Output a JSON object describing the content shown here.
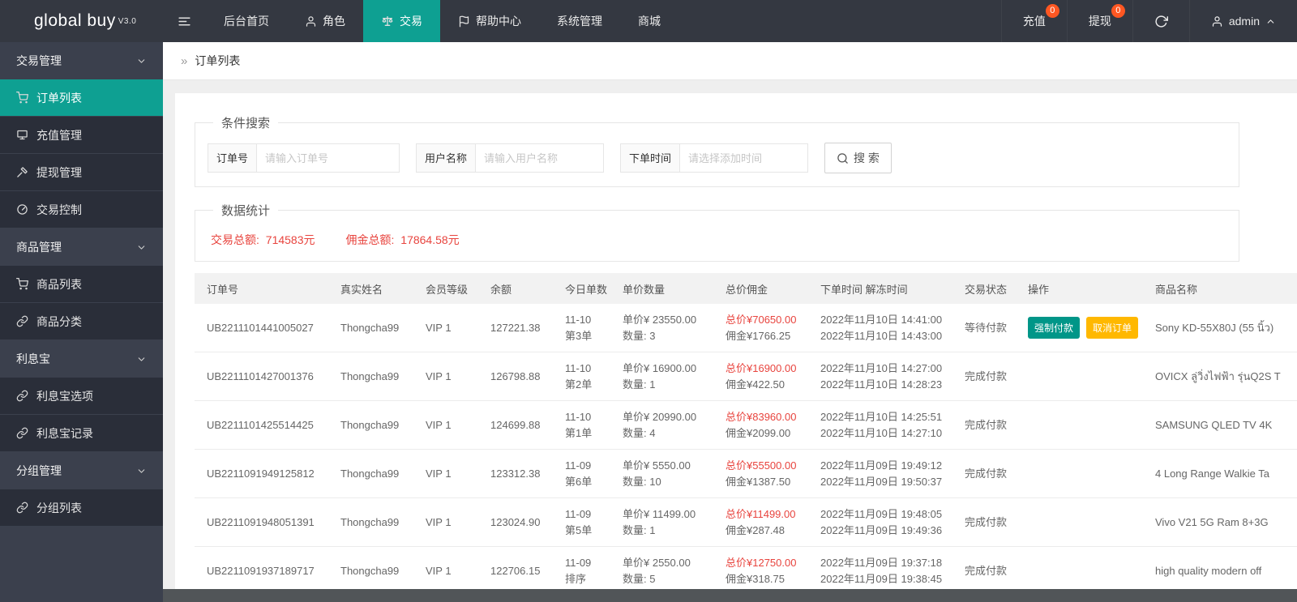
{
  "brand": {
    "name": "global buy",
    "version": "V3.0"
  },
  "topnav": {
    "menu": [
      {
        "label": "后台首页",
        "icon": null,
        "active": false
      },
      {
        "label": "角色",
        "icon": "person",
        "active": false
      },
      {
        "label": "交易",
        "icon": "scales",
        "active": true
      },
      {
        "label": "帮助中心",
        "icon": "flag",
        "active": false
      },
      {
        "label": "系统管理",
        "icon": null,
        "active": false
      },
      {
        "label": "商城",
        "icon": null,
        "active": false
      }
    ],
    "recharge_label": "充值",
    "recharge_badge": "0",
    "withdraw_label": "提现",
    "withdraw_badge": "0",
    "username": "admin"
  },
  "sidebar": {
    "sections": [
      {
        "label": "交易管理",
        "items": [
          {
            "label": "订单列表",
            "icon": "cart",
            "active": true
          },
          {
            "label": "充值管理",
            "icon": "board",
            "active": false
          },
          {
            "label": "提现管理",
            "icon": "gavel",
            "active": false
          },
          {
            "label": "交易控制",
            "icon": "gauge",
            "active": false
          }
        ]
      },
      {
        "label": "商品管理",
        "items": [
          {
            "label": "商品列表",
            "icon": "cart",
            "active": false
          },
          {
            "label": "商品分类",
            "icon": "link",
            "active": false
          }
        ]
      },
      {
        "label": "利息宝",
        "items": [
          {
            "label": "利息宝选项",
            "icon": "link",
            "active": false
          },
          {
            "label": "利息宝记录",
            "icon": "link",
            "active": false
          }
        ]
      },
      {
        "label": "分组管理",
        "items": [
          {
            "label": "分组列表",
            "icon": "link",
            "active": false
          }
        ]
      }
    ]
  },
  "breadcrumb": {
    "marker": "»",
    "title": "订单列表"
  },
  "search": {
    "legend": "条件搜索",
    "fields": [
      {
        "label": "订单号",
        "placeholder": "请输入订单号"
      },
      {
        "label": "用户名称",
        "placeholder": "请输入用户名称"
      },
      {
        "label": "下单时间",
        "placeholder": "请选择添加时间"
      }
    ],
    "button_label": "搜 索"
  },
  "stats": {
    "legend": "数据统计",
    "items": [
      {
        "label": "交易总额:",
        "value": "714583元"
      },
      {
        "label": "佣金总额:",
        "value": "17864.58元"
      }
    ]
  },
  "table": {
    "headers": [
      "订单号",
      "真实姓名",
      "会员等级",
      "余额",
      "今日单数",
      "单价数量",
      "总价佣金",
      "下单时间 解冻时间",
      "交易状态",
      "操作",
      "商品名称"
    ],
    "rows": [
      {
        "order_no": "UB2211101441005027",
        "real_name": "Thongcha99",
        "vip_level": "VIP 1",
        "balance": "127221.38",
        "today_date": "11-10",
        "today_seq": "第3单",
        "unit_price": "单价¥ 23550.00",
        "quantity": "数量: 3",
        "total_price": "总价¥70650.00",
        "commission": "佣金¥1766.25",
        "order_time": "2022年11月10日 14:41:00",
        "unfreeze_time": "2022年11月10日 14:43:00",
        "status": "等待付款",
        "actions": [
          "强制付款",
          "取消订单"
        ],
        "product": "Sony KD-55X80J (55 นิ้ว)"
      },
      {
        "order_no": "UB2211101427001376",
        "real_name": "Thongcha99",
        "vip_level": "VIP 1",
        "balance": "126798.88",
        "today_date": "11-10",
        "today_seq": "第2单",
        "unit_price": "单价¥ 16900.00",
        "quantity": "数量: 1",
        "total_price": "总价¥16900.00",
        "commission": "佣金¥422.50",
        "order_time": "2022年11月10日 14:27:00",
        "unfreeze_time": "2022年11月10日 14:28:23",
        "status": "完成付款",
        "actions": [],
        "product": "OVICX ลู่วิ่งไฟฟ้า รุ่นQ2S T"
      },
      {
        "order_no": "UB2211101425514425",
        "real_name": "Thongcha99",
        "vip_level": "VIP 1",
        "balance": "124699.88",
        "today_date": "11-10",
        "today_seq": "第1单",
        "unit_price": "单价¥ 20990.00",
        "quantity": "数量: 4",
        "total_price": "总价¥83960.00",
        "commission": "佣金¥2099.00",
        "order_time": "2022年11月10日 14:25:51",
        "unfreeze_time": "2022年11月10日 14:27:10",
        "status": "完成付款",
        "actions": [],
        "product": "SAMSUNG QLED TV 4K"
      },
      {
        "order_no": "UB2211091949125812",
        "real_name": "Thongcha99",
        "vip_level": "VIP 1",
        "balance": "123312.38",
        "today_date": "11-09",
        "today_seq": "第6单",
        "unit_price": "单价¥ 5550.00",
        "quantity": "数量: 10",
        "total_price": "总价¥55500.00",
        "commission": "佣金¥1387.50",
        "order_time": "2022年11月09日 19:49:12",
        "unfreeze_time": "2022年11月09日 19:50:37",
        "status": "完成付款",
        "actions": [],
        "product": "4 Long Range Walkie Ta"
      },
      {
        "order_no": "UB2211091948051391",
        "real_name": "Thongcha99",
        "vip_level": "VIP 1",
        "balance": "123024.90",
        "today_date": "11-09",
        "today_seq": "第5单",
        "unit_price": "单价¥ 11499.00",
        "quantity": "数量: 1",
        "total_price": "总价¥11499.00",
        "commission": "佣金¥287.48",
        "order_time": "2022年11月09日 19:48:05",
        "unfreeze_time": "2022年11月09日 19:49:36",
        "status": "完成付款",
        "actions": [],
        "product": "Vivo V21 5G Ram 8+3G"
      },
      {
        "order_no": "UB2211091937189717",
        "real_name": "Thongcha99",
        "vip_level": "VIP 1",
        "balance": "122706.15",
        "today_date": "11-09",
        "today_seq": "排序",
        "unit_price": "单价¥ 2550.00",
        "quantity": "数量: 5",
        "total_price": "总价¥12750.00",
        "commission": "佣金¥318.75",
        "order_time": "2022年11月09日 19:37:18",
        "unfreeze_time": "2022年11月09日 19:38:45",
        "status": "完成付款",
        "actions": [],
        "product": "high quality modern off"
      }
    ]
  },
  "colors": {
    "accent_teal": "#0ea092",
    "button_teal": "#009688",
    "button_yellow": "#FFB800",
    "alert_red": "#e8443e",
    "badge_red": "#ff5722",
    "dark_bar": "#343841"
  },
  "icons": {
    "hamburger": "three horizontal bars",
    "person": "user outline",
    "scales": "balance scale",
    "flag": "flag on pole",
    "refresh": "circular arrow",
    "chevron-up": "˄",
    "chevron-down": "˅",
    "cart": "shopping cart",
    "board": "display board",
    "gavel": "gavel",
    "gauge": "speedometer dial",
    "link": "chain link",
    "search": "magnifier",
    "breadcrumb-marker": "»"
  }
}
